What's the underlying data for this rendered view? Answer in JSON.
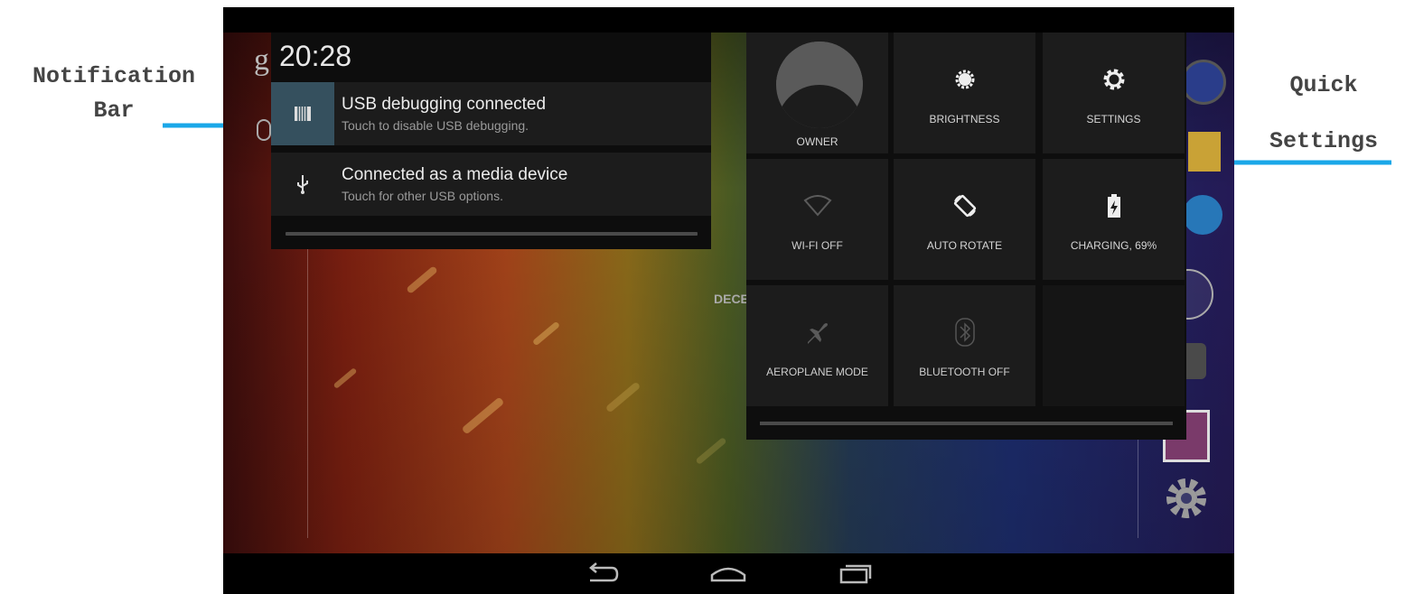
{
  "annotations": {
    "notification_bar": [
      "Notification",
      "Bar"
    ],
    "quick_settings": [
      "Quick",
      "Settings"
    ]
  },
  "status": {
    "clock": "20:28",
    "wallpaper_date_fragment": "DECE",
    "wallpaper_search_fragment": "g"
  },
  "notifications": [
    {
      "title": "USB debugging connected",
      "subtitle": "Touch to disable USB debugging.",
      "icon": "usb-debug-icon"
    },
    {
      "title": "Connected as a media device",
      "subtitle": "Touch for other USB options.",
      "icon": "usb-icon"
    }
  ],
  "quick_settings": {
    "tiles": [
      {
        "label": "OWNER",
        "icon": "user-avatar-icon"
      },
      {
        "label": "BRIGHTNESS",
        "icon": "brightness-icon"
      },
      {
        "label": "SETTINGS",
        "icon": "gear-icon"
      },
      {
        "label": "WI-FI OFF",
        "icon": "wifi-off-icon"
      },
      {
        "label": "AUTO ROTATE",
        "icon": "auto-rotate-icon"
      },
      {
        "label": "CHARGING, 69%",
        "icon": "battery-charging-icon"
      },
      {
        "label": "AEROPLANE MODE",
        "icon": "airplane-icon"
      },
      {
        "label": "BLUETOOTH OFF",
        "icon": "bluetooth-off-icon"
      }
    ]
  },
  "navigation": {
    "buttons": [
      "back-icon",
      "home-icon",
      "recent-apps-icon"
    ]
  },
  "colors": {
    "annotation_arrow": "#1aa7e8",
    "panel_bg": "#0d0d0d",
    "tile_bg": "#1c1c1c",
    "text_primary": "#ececec",
    "text_secondary": "#9a9a9a"
  }
}
